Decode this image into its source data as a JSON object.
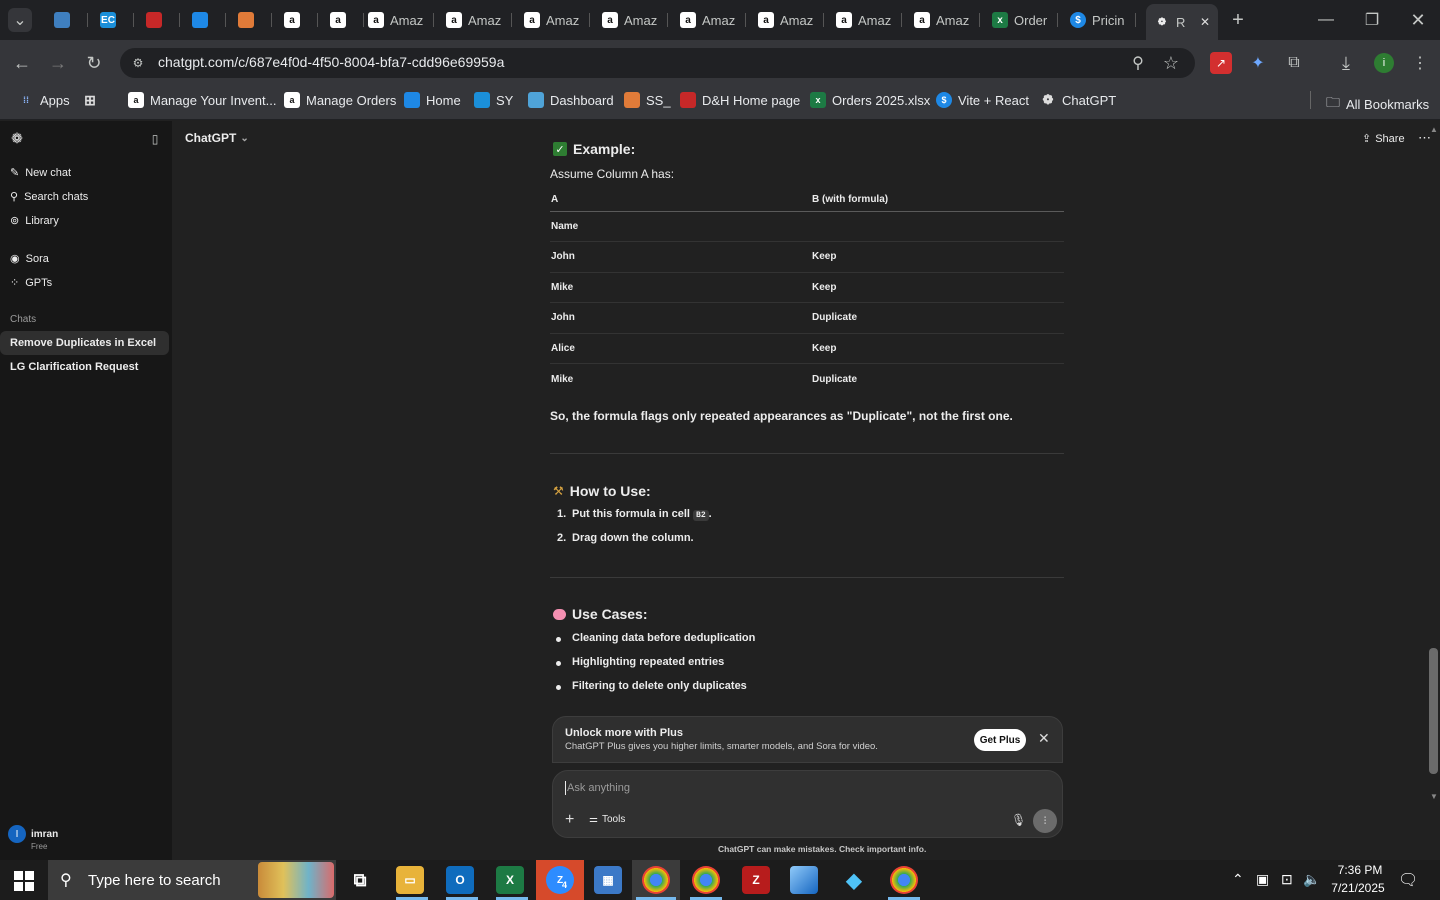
{
  "browser": {
    "tabs": [
      {
        "label": "",
        "icon": "list-icon"
      },
      {
        "label": "",
        "icon": "app-icon"
      },
      {
        "label": "",
        "icon": "ec-icon"
      },
      {
        "label": "",
        "icon": "dh-icon"
      },
      {
        "label": "",
        "icon": "doc-icon"
      },
      {
        "label": "",
        "icon": "stack-icon"
      },
      {
        "label": "",
        "icon": "amazon-icon"
      },
      {
        "label": "",
        "icon": "amazon-icon"
      },
      {
        "label": "Amaz",
        "icon": "amazon-icon"
      },
      {
        "label": "Amaz",
        "icon": "amazon-icon"
      },
      {
        "label": "Amaz",
        "icon": "amazon-icon"
      },
      {
        "label": "Amaz",
        "icon": "amazon-icon"
      },
      {
        "label": "Amaz",
        "icon": "amazon-icon"
      },
      {
        "label": "Amaz",
        "icon": "amazon-icon"
      },
      {
        "label": "Amaz",
        "icon": "amazon-icon"
      },
      {
        "label": "Amaz",
        "icon": "amazon-icon"
      },
      {
        "label": "Order",
        "icon": "excel-icon"
      },
      {
        "label": "Pricin",
        "icon": "dollar-icon"
      },
      {
        "label": "R",
        "icon": "openai-icon"
      }
    ],
    "url": "chatgpt.com/c/687e4f0d-4f50-8004-bfa7-cdd96e69959a",
    "bookmarks": [
      {
        "label": "Apps"
      },
      {
        "label": ""
      },
      {
        "label": "Manage Your Invent..."
      },
      {
        "label": "Manage Orders"
      },
      {
        "label": "Home"
      },
      {
        "label": "SY"
      },
      {
        "label": "Dashboard"
      },
      {
        "label": "SS_"
      },
      {
        "label": "D&H Home page"
      },
      {
        "label": "Orders 2025.xlsx"
      },
      {
        "label": "Vite + React"
      },
      {
        "label": "ChatGPT"
      }
    ],
    "all_bookmarks": "All Bookmarks"
  },
  "sidebar": {
    "nav": [
      "New chat",
      "Search chats",
      "Library"
    ],
    "apps": [
      "Sora",
      "GPTs"
    ],
    "section_title": "Chats",
    "chats": [
      "Remove Duplicates in Excel",
      "LG Clarification Request"
    ],
    "user": {
      "name": "imran",
      "plan": "Free",
      "initial": "I"
    }
  },
  "header": {
    "model": "ChatGPT",
    "share": "Share"
  },
  "message": {
    "example_heading": "Example:",
    "example_intro": "Assume Column A has:",
    "table": {
      "headers": [
        "A",
        "B (with formula)"
      ],
      "rows": [
        [
          "Name",
          ""
        ],
        [
          "John",
          "Keep"
        ],
        [
          "Mike",
          "Keep"
        ],
        [
          "John",
          "Duplicate"
        ],
        [
          "Alice",
          "Keep"
        ],
        [
          "Mike",
          "Duplicate"
        ]
      ]
    },
    "conclusion": "So, the formula flags only repeated appearances as \"Duplicate\", not the first one.",
    "howto_heading": "How to Use:",
    "howto_steps": [
      {
        "num": "1.",
        "pre": "Put this formula in cell ",
        "code": "B2",
        "post": "."
      },
      {
        "num": "2.",
        "pre": "Drag down the column.",
        "code": "",
        "post": ""
      }
    ],
    "usecases_heading": "Use Cases:",
    "usecases": [
      "Cleaning data before deduplication",
      "Highlighting repeated entries",
      "Filtering to delete only duplicates"
    ]
  },
  "banner": {
    "title": "Unlock more with Plus",
    "subtitle": "ChatGPT Plus gives you higher limits, smarter models, and Sora for video.",
    "button": "Get Plus"
  },
  "composer": {
    "placeholder": "Ask anything",
    "tools": "Tools"
  },
  "footer_note": "ChatGPT can make mistakes. Check important info.",
  "taskbar": {
    "search_placeholder": "Type here to search",
    "time": "7:36 PM",
    "date": "7/21/2025",
    "zoom_badge": "4"
  }
}
